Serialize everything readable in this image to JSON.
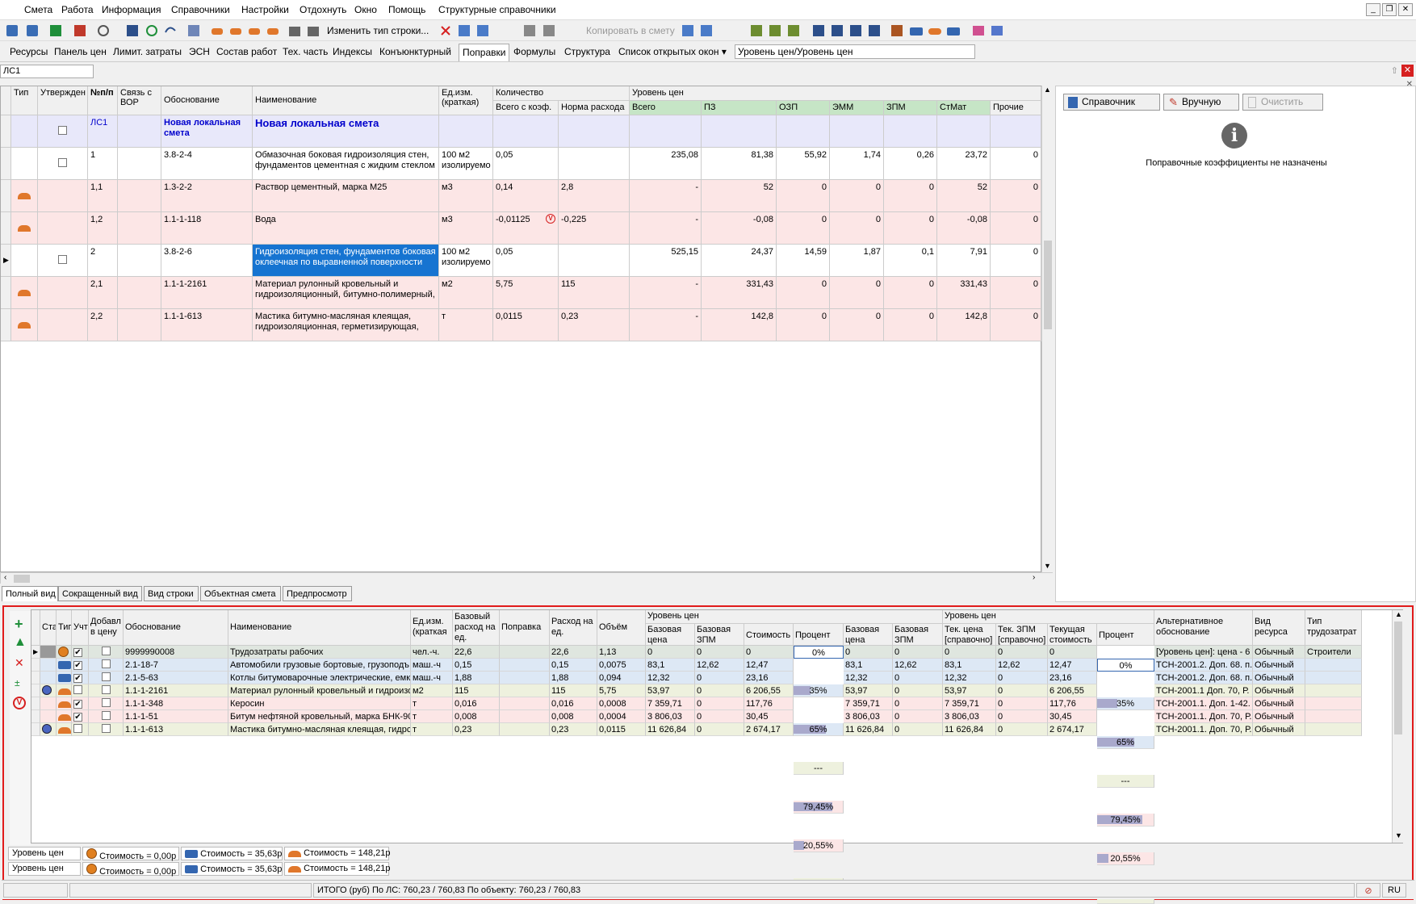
{
  "menu": [
    "Смета",
    "Работа",
    "Информация",
    "Справочники",
    "Настройки",
    "Отдохнуть",
    "Окно",
    "Помощь",
    "Структурные справочники"
  ],
  "toolbar": {
    "change_row_type": "Изменить тип строки...",
    "copy_to_estimate": "Копировать в смету"
  },
  "tabs2": [
    "Ресурсы",
    "Панель цен",
    "Лимит. затраты",
    "ЭСН",
    "Состав работ",
    "Тех. часть",
    "Индексы",
    "Конъюнктурный",
    "Поправки",
    "Формулы",
    "Структура",
    "Список открытых окон ▾",
    "Уровень цен/Уровень цен"
  ],
  "ls_label": "ЛС1",
  "grid": {
    "headers": {
      "type": "Тип",
      "approved": "Утвержден",
      "num": "№п/п",
      "vor": "Связь с ВОР",
      "basis": "Обоснование",
      "name": "Наименование",
      "unit": "Ед.изм. (краткая)",
      "qty": "Количество",
      "qty_total": "Всего с коэф.",
      "qty_norm": "Норма расхода",
      "price_level": "Уровень цен",
      "total": "Всего",
      "pz": "ПЗ",
      "ozp": "ОЗП",
      "emm": "ЭММ",
      "zpm": "ЗПМ",
      "stmat": "СтМат",
      "other": "Прочие"
    },
    "rows": [
      {
        "num": "ЛС1",
        "basis": "Новая локальная смета",
        "name": "Новая локальная смета",
        "unit": "",
        "qty": "",
        "norm": "",
        "total": "",
        "pz": "",
        "ozp": "",
        "emm": "",
        "zpm": "",
        "stmat": "",
        "other": ""
      },
      {
        "num": "1",
        "basis": "3.8-2-4",
        "name": "Обмазочная боковая гидроизоляция стен, фундаментов цементная с жидким стеклом",
        "unit": "100 м2 изолируемо",
        "qty": "0,05",
        "norm": "",
        "total": "235,08",
        "pz": "81,38",
        "ozp": "55,92",
        "emm": "1,74",
        "zpm": "0,26",
        "stmat": "23,72",
        "other": "0"
      },
      {
        "num": "1,1",
        "basis": "1.3-2-2",
        "name": "Раствор цементный, марка М25",
        "unit": "м3",
        "qty": "0,14",
        "norm": "2,8",
        "total": "-",
        "pz": "52",
        "ozp": "0",
        "emm": "0",
        "zpm": "0",
        "stmat": "52",
        "other": "0"
      },
      {
        "num": "1,2",
        "basis": "1.1-1-118",
        "name": "Вода",
        "unit": "м3",
        "qty": "-0,01125",
        "norm": "-0,225",
        "total": "-",
        "pz": "-0,08",
        "ozp": "0",
        "emm": "0",
        "zpm": "0",
        "stmat": "-0,08",
        "other": "0"
      },
      {
        "num": "2",
        "basis": "3.8-2-6",
        "name": "Гидроизоляция стен, фундаментов боковая оклеечная по выравненной поверхности",
        "unit": "100 м2 изолируемо",
        "qty": "0,05",
        "norm": "",
        "total": "525,15",
        "pz": "24,37",
        "ozp": "14,59",
        "emm": "1,87",
        "zpm": "0,1",
        "stmat": "7,91",
        "other": "0"
      },
      {
        "num": "2,1",
        "basis": "1.1-1-2161",
        "name": "Материал рулонный кровельный и гидроизоляционный, битумно-полимерный,",
        "unit": "м2",
        "qty": "5,75",
        "norm": "115",
        "total": "-",
        "pz": "331,43",
        "ozp": "0",
        "emm": "0",
        "zpm": "0",
        "stmat": "331,43",
        "other": "0"
      },
      {
        "num": "2,2",
        "basis": "1.1-1-613",
        "name": "Мастика битумно-масляная клеящая, гидроизоляционная, герметизирующая,",
        "unit": "т",
        "qty": "0,0115",
        "norm": "0,23",
        "total": "-",
        "pz": "142,8",
        "ozp": "0",
        "emm": "0",
        "zpm": "0",
        "stmat": "142,8",
        "other": "0"
      }
    ]
  },
  "right_panel": {
    "btn_ref": "Справочник",
    "btn_manual": "Вручную",
    "btn_clear": "Очистить",
    "info": "Поправочные коэффициенты не назначены"
  },
  "view_tabs": [
    "Полный вид",
    "Сокращенный вид",
    "Вид строки",
    "Объектная смета",
    "Предпросмотр"
  ],
  "bottom": {
    "headers": {
      "st": "Ста",
      "type": "Тип",
      "uch": "Учт",
      "added": "Добавл в цену",
      "basis": "Обоснование",
      "name": "Наименование",
      "unit": "Ед.изм. (краткая",
      "base_rate": "Базовый расход на ед.",
      "corr": "Поправка",
      "rate": "Расход на ед.",
      "volume": "Объём",
      "pl1": "Уровень цен",
      "bprice": "Базовая цена",
      "bzpm": "Базовая ЗПМ",
      "cost": "Стоимость",
      "pct": "Процент",
      "bprice2": "Базовая цена",
      "bzpm2": "Базовая ЗПМ",
      "pl2": "Уровень цен",
      "tprice": "Тек. цена [справочно]",
      "tzpm": "Тек. ЗПМ [справочно]",
      "tcost": "Текущая стоимость",
      "pct2": "Процент",
      "alt": "Альтернативное обоснование",
      "rtype": "Вид ресурса",
      "ctype": "Тип трудозатрат"
    },
    "rows": [
      {
        "icon": "worker",
        "checked": true,
        "basis": "9999990008",
        "name": "Трудозатраты рабочих",
        "unit": "чел.-ч.",
        "base_rate": "22,6",
        "rate": "22,6",
        "volume": "1,13",
        "bprice": "0",
        "bzpm": "0",
        "cost": "0",
        "pct": "0%",
        "pct_val": 0,
        "bprice2": "0",
        "bzpm2": "0",
        "tprice": "0",
        "tzpm": "0",
        "tcost": "0",
        "pct2": "0%",
        "alt": "[Уровень цен]: цена - 6",
        "rtype": "Обычный",
        "ctype": "Строители"
      },
      {
        "icon": "truck",
        "checked": true,
        "basis": "2.1-18-7",
        "name": "Автомобили грузовые бортовые, грузоподъ",
        "unit": "маш.-ч",
        "base_rate": "0,15",
        "rate": "0,15",
        "volume": "0,0075",
        "bprice": "83,1",
        "bzpm": "12,62",
        "cost": "12,47",
        "pct": "35%",
        "pct_val": 35,
        "bprice2": "83,1",
        "bzpm2": "12,62",
        "tprice": "83,1",
        "tzpm": "12,62",
        "tcost": "12,47",
        "pct2": "35%",
        "alt": "ТСН-2001.2. Доп. 68. п.",
        "rtype": "Обычный",
        "ctype": ""
      },
      {
        "icon": "truck",
        "checked": true,
        "basis": "2.1-5-63",
        "name": "Котлы битумоварочные электрические, емк",
        "unit": "маш.-ч",
        "base_rate": "1,88",
        "rate": "1,88",
        "volume": "0,094",
        "bprice": "12,32",
        "bzpm": "0",
        "cost": "23,16",
        "pct": "65%",
        "pct_val": 65,
        "bprice2": "12,32",
        "bzpm2": "0",
        "tprice": "12,32",
        "tzpm": "0",
        "tcost": "23,16",
        "pct2": "65%",
        "alt": "ТСН-2001.2. Доп. 68. п.",
        "rtype": "Обычный",
        "ctype": ""
      },
      {
        "icon": "brick",
        "globe": true,
        "checked": false,
        "basis": "1.1-1-2161",
        "name": "Материал рулонный кровельный и гидроизо",
        "unit": "м2",
        "base_rate": "115",
        "rate": "115",
        "volume": "5,75",
        "bprice": "53,97",
        "bzpm": "0",
        "cost": "6 206,55",
        "pct": "---",
        "pct_val": 0,
        "bprice2": "53,97",
        "bzpm2": "0",
        "tprice": "53,97",
        "tzpm": "0",
        "tcost": "6 206,55",
        "pct2": "---",
        "alt": "ТСН-2001.1 Доп. 70, Р.",
        "rtype": "Обычный",
        "ctype": ""
      },
      {
        "icon": "brick",
        "checked": true,
        "basis": "1.1-1-348",
        "name": "Керосин",
        "unit": "т",
        "base_rate": "0,016",
        "rate": "0,016",
        "volume": "0,0008",
        "bprice": "7 359,71",
        "bzpm": "0",
        "cost": "117,76",
        "pct": "79,45%",
        "pct_val": 79.45,
        "bprice2": "7 359,71",
        "bzpm2": "0",
        "tprice": "7 359,71",
        "tzpm": "0",
        "tcost": "117,76",
        "pct2": "79,45%",
        "alt": "ТСН-2001.1. Доп. 1-42.",
        "rtype": "Обычный",
        "ctype": ""
      },
      {
        "icon": "brick",
        "checked": true,
        "basis": "1.1-1-51",
        "name": "Битум нефтяной кровельный, марка БНК-90",
        "unit": "т",
        "base_rate": "0,008",
        "rate": "0,008",
        "volume": "0,0004",
        "bprice": "3 806,03",
        "bzpm": "0",
        "cost": "30,45",
        "pct": "20,55%",
        "pct_val": 20.55,
        "bprice2": "3 806,03",
        "bzpm2": "0",
        "tprice": "3 806,03",
        "tzpm": "0",
        "tcost": "30,45",
        "pct2": "20,55%",
        "alt": "ТСН-2001.1. Доп. 70, Р.",
        "rtype": "Обычный",
        "ctype": ""
      },
      {
        "icon": "brick",
        "globe": true,
        "checked": false,
        "basis": "1.1-1-613",
        "name": "Мастика битумно-масляная клеящая, гидрс",
        "unit": "т",
        "base_rate": "0,23",
        "rate": "0,23",
        "volume": "0,0115",
        "bprice": "11 626,84",
        "bzpm": "0",
        "cost": "2 674,17",
        "pct": "---",
        "pct_val": 0,
        "bprice2": "11 626,84",
        "bzpm2": "0",
        "tprice": "11 626,84",
        "tzpm": "0",
        "tcost": "2 674,17",
        "pct2": "---",
        "alt": "ТСН-2001.1. Доп. 70, Р.",
        "rtype": "Обычный",
        "ctype": ""
      }
    ]
  },
  "summary": {
    "label": "Уровень цен",
    "c1": "Стоимость = 0,00р",
    "c2": "Стоимость = 35,63р",
    "c3": "Стоимость = 148,21р"
  },
  "status": {
    "total": "ИТОГО (руб)   По ЛС: 760,23 / 760,83     По объекту: 760,23 / 760,83",
    "lang": "RU"
  }
}
